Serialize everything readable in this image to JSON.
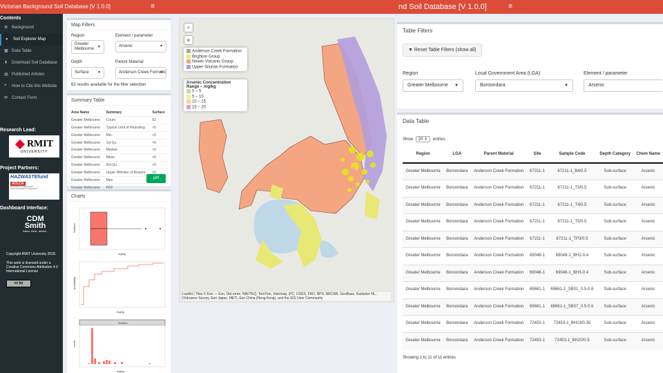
{
  "left_app": {
    "title": "Victorian Background Soil Database [V 1.0.0]",
    "menu_icon": "≡"
  },
  "sidebar": {
    "heading": "Contents",
    "items": [
      {
        "label": "Background",
        "icon": "gear-icon",
        "glyph": "⚙"
      },
      {
        "label": "Soil Explorer Map",
        "icon": "map-marker-icon",
        "glyph": "●"
      },
      {
        "label": "Data Table",
        "icon": "table-icon",
        "glyph": "▦"
      },
      {
        "label": "Download Soil Database",
        "icon": "download-icon",
        "glyph": "⬇"
      },
      {
        "label": "Published Articles",
        "icon": "file-icon",
        "glyph": "▤"
      },
      {
        "label": "How to Cite this Website",
        "icon": "quote-icon",
        "glyph": "❝"
      },
      {
        "label": "Contact Form",
        "icon": "envelope-icon",
        "glyph": "✉"
      }
    ],
    "research_lead": "Research Lead:",
    "rmit_logo_text": "RMIT",
    "rmit_logo_sub": "UNIVERSITY",
    "project_partners": "Project Partners:",
    "haz_logo_text": "HAZWASTEfund",
    "acla_text": "ACLCA",
    "acla_sub": "Australian Contaminated Land Consultants Association",
    "dashboard_interface": "Dashboard Interface:",
    "cdm_line1": "CDM",
    "cdm_line2": "Smith",
    "cdm_tagline": "listen. think. deliver.",
    "copyright": "Copyright RMIT University 2018.",
    "license": "This work is licensed under a Creative Commons Attribution 4.0 International License",
    "cc_badge": "cc by"
  },
  "map_filters": {
    "title": "Map Filters",
    "region_label": "Region",
    "region_value": "Greater Melbourne",
    "element_label": "Element / parameter",
    "element_value": "Arsenic",
    "depth_label": "Depth",
    "depth_value": "Surface",
    "parent_label": "Parent Material",
    "parent_value": "Anderson Creek Formatio",
    "results_text": "62 results available for the filter selection"
  },
  "summary_table": {
    "title": "Summary Table",
    "headers": [
      "Area Name",
      "Summary",
      "Surface"
    ],
    "rows": [
      [
        "Greater Melbourne",
        "Count",
        "62"
      ],
      [
        "Greater Melbourne",
        "Typical Limit of Reporting",
        "<5"
      ],
      [
        "Greater Melbourne",
        "Min.",
        "<5"
      ],
      [
        "Greater Melbourne",
        "1st Qu.",
        "<5"
      ],
      [
        "Greater Melbourne",
        "Median",
        "<5"
      ],
      [
        "Greater Melbourne",
        "Mean",
        "<5"
      ],
      [
        "Greater Melbourne",
        "3rd Qu.",
        "<5"
      ],
      [
        "Greater Melbourne",
        "Upper Whisker of Boxplot",
        "10"
      ],
      [
        "Greater Melbourne",
        "Max.",
        "16"
      ],
      [
        "Greater Melbourne",
        "PDF",
        ""
      ]
    ],
    "pdf_button": "pdf"
  },
  "charts": {
    "title": "Charts",
    "boxplot_ylabel": "Surface",
    "boxplot_xlabel": "mg/kg",
    "ecdf_ylabel": "probability",
    "ecdf_xlabel": "mg/kg",
    "hist_strip": "Surface",
    "hist_ylabel": "count",
    "hist_xlabel": "mg/kg"
  },
  "map": {
    "search_icon": "search-icon",
    "layers_icon": "layers-icon",
    "legend_geology": [
      {
        "label": "Anderson Creek Formation",
        "color": "#a6a6a6"
      },
      {
        "label": "Brighton Group",
        "color": "#e8e874"
      },
      {
        "label": "Newer Volcanic Group",
        "color": "#f4a582"
      },
      {
        "label": "Upper Silurian Formation",
        "color": "#b39ddb"
      }
    ],
    "legend_conc_title": "Arsenic Concentration Range – mg/kg",
    "legend_conc": [
      {
        "label": "0 – 5",
        "color": "#b7e4a7"
      },
      {
        "label": "5 – 10",
        "color": "#f5f08a"
      },
      {
        "label": "10 – 15",
        "color": "#f6d38c"
      },
      {
        "label": "15 – 20",
        "color": "#d8a0c8"
      }
    ],
    "attribution": "Leaflet | Tiles © Esri — Esri, DeLorme, NAVTEQ, TomTom, Intermap, iPC, USGS, FAO, NPS, NRCAN, GeoBase, Kadaster NL, Ordnance Survey, Esri Japan, METI, Esri China (Hong Kong), and the GIS User Community",
    "colors": {
      "newer_volcanic": "#f4a582",
      "silurian": "#b39ddb",
      "brighton": "#e8e874",
      "samples": "#e6e619",
      "water": "#bfd8e8"
    }
  },
  "right_app": {
    "title": "nd Soil Database [V 1.0.0]",
    "menu_icon": "≡",
    "table_filters_title": "Table Filters",
    "reset_button": "Reset Table Filters (show all)",
    "region_label": "Region",
    "region_value": "Greater Melbourne",
    "lga_label": "Local Government Area (LGA)",
    "lga_value": "Boroondara",
    "element_label": "Element / parameter",
    "element_value": "Arsenic",
    "data_table_title": "Data Table",
    "show_label": "Show",
    "show_value": "20",
    "entries_label": "entries",
    "headers": [
      "Region",
      "LGA",
      "Parent Material",
      "Site",
      "Sample Code",
      "Depth Category",
      "Chem Name"
    ],
    "rows": [
      [
        "Greater Melbourne",
        "Boroondara",
        "Anderson Creek Formation",
        "67211-1",
        "67211-1_B4/0.5",
        "Sub-surface",
        "Arsenic"
      ],
      [
        "Greater Melbourne",
        "Boroondara",
        "Anderson Creek Formation",
        "67211-1",
        "67211-1_T3/0.5",
        "Sub-surface",
        "Arsenic"
      ],
      [
        "Greater Melbourne",
        "Boroondara",
        "Anderson Creek Formation",
        "67211-1",
        "67211-1_T4/0.5",
        "Sub-surface",
        "Arsenic"
      ],
      [
        "Greater Melbourne",
        "Boroondara",
        "Anderson Creek Formation",
        "67211-1",
        "67211-1_T5/0.5",
        "Sub-surface",
        "Arsenic"
      ],
      [
        "Greater Melbourne",
        "Boroondara",
        "Anderson Creek Formation",
        "67211-1",
        "67211-1_TP3/0.5",
        "Sub-surface",
        "Arsenic"
      ],
      [
        "Greater Melbourne",
        "Boroondara",
        "Anderson Creek Formation",
        "69048-1",
        "69048-1_BH2-0.4",
        "Sub-surface",
        "Arsenic"
      ],
      [
        "Greater Melbourne",
        "Boroondara",
        "Anderson Creek Formation",
        "69048-1",
        "69048-1_BH3-0.4",
        "Sub-surface",
        "Arsenic"
      ],
      [
        "Greater Melbourne",
        "Boroondara",
        "Anderson Creek Formation",
        "69661-1",
        "69661-1_SB01_0.5-0.6",
        "Sub-surface",
        "Arsenic"
      ],
      [
        "Greater Melbourne",
        "Boroondara",
        "Anderson Creek Formation",
        "69661-1",
        "69661-1_SB07_0.5-0.6",
        "Sub-surface",
        "Arsenic"
      ],
      [
        "Greater Melbourne",
        "Boroondara",
        "Anderson Creek Formation",
        "72453-1",
        "72453-1_BH13/0.35",
        "Sub-surface",
        "Arsenic"
      ],
      [
        "Greater Melbourne",
        "Boroondara",
        "Anderson Creek Formation",
        "72453-1",
        "72453-1_BH20/0.5",
        "Sub-surface",
        "Arsenic"
      ]
    ],
    "info_text": "Showing 1 to 11 of 11 entries"
  }
}
